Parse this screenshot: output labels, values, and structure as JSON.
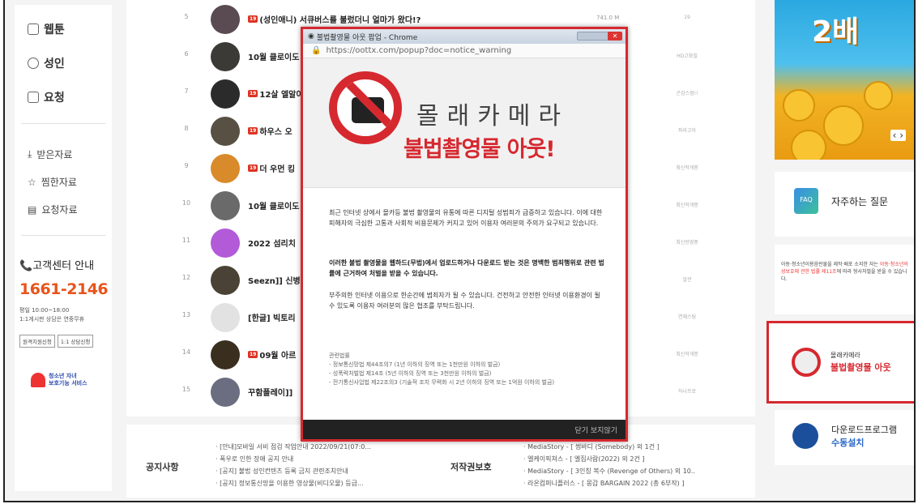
{
  "sidebar": {
    "menu": [
      {
        "label": "웹툰",
        "icon": "book-icon"
      },
      {
        "label": "성인",
        "icon": "adult-icon"
      },
      {
        "label": "요청",
        "icon": "request-icon"
      }
    ],
    "sub": [
      {
        "label": "받은자료",
        "icon": "download-icon"
      },
      {
        "label": "찜한자료",
        "icon": "star-icon"
      },
      {
        "label": "요청자료",
        "icon": "request-list-icon"
      }
    ],
    "cs_title": "고객센터 안내",
    "cs_phone": "1661-2146",
    "cs_hours1": "평일 10:00~18:00",
    "cs_hours2": "1:1게시판 상담은 연중무휴",
    "cs_btn1": "원격지원신청",
    "cs_btn2": "1:1 상담신청",
    "youth1": "청소년 자녀",
    "youth2": "보호기능 서비스"
  },
  "list": [
    {
      "num": "5",
      "title": "(성인애니) 서큐버스를 불렀더니 얼마가 왔다!?",
      "badge": "19",
      "meta": "19",
      "size": "741.0 M",
      "thumb": "#5a4a52"
    },
    {
      "num": "6",
      "title": "10월 클로이도",
      "badge": "",
      "meta": "HD고화질",
      "size": "",
      "thumb": "#3c3a36"
    },
    {
      "num": "7",
      "title": "12살 엘알이",
      "badge": "19",
      "meta": "곤감스점!!",
      "size": "",
      "thumb": "#2b2b2b"
    },
    {
      "num": "8",
      "title": "하우스 오",
      "badge": "19",
      "meta": "파라고아",
      "size": "",
      "thumb": "#585042"
    },
    {
      "num": "9",
      "title": "더 우먼 킹",
      "badge": "19",
      "meta": "최신작개봉",
      "size": "",
      "thumb": "#d98a2a"
    },
    {
      "num": "10",
      "title": "10월 클로이도",
      "badge": "",
      "meta": "최신작개봉",
      "size": "",
      "thumb": "#6a6a6a"
    },
    {
      "num": "11",
      "title": "2022 섬리치",
      "badge": "",
      "meta": "최신방영중",
      "size": "",
      "thumb": "#b25ad8"
    },
    {
      "num": "12",
      "title": "Seezn]] 신병",
      "badge": "",
      "meta": "알관",
      "size": "",
      "thumb": "#4a4234"
    },
    {
      "num": "13",
      "title": "[한글] 빅토리",
      "badge": "",
      "meta": "연체스팀",
      "size": "",
      "thumb": "#e2e2e2"
    },
    {
      "num": "14",
      "title": "09월 아르",
      "badge": "19",
      "meta": "최신작개봉",
      "size": "",
      "thumb": "#3a2e1e"
    },
    {
      "num": "15",
      "title": "꾸함플레이]]",
      "badge": "",
      "meta": "하나프로",
      "size": "",
      "thumb": "#6a6e80"
    }
  ],
  "notice": {
    "title": "공지사항",
    "items": [
      "· [안내]모바일 서비 점검 작업안내 2022/09/21(07:0...",
      "· 폭우로 인한 장애 공지 안내",
      "· [공지] 불법 성인컨텐츠 등록 금지 관련조치안내",
      "· [공지] 정보통신망을 이용한 영상물(비디오물) 등급..."
    ],
    "copyright_title": "저작권보호",
    "copyright_items": [
      "· MediaStory - [ 썸바디 (Somebody) 외 1건 ]",
      "· 엘케이픽쳐스 - [ 엘집사람(2022) 외 2건 ]",
      "· MediaStory - [ 3인칭 복수 (Revenge of Others) 외 10..",
      "· 라온컴퍼니플러스 - [ 몽갑 BARGAIN 2022 (총 6부작) ]"
    ]
  },
  "right": {
    "ad_big": "2배",
    "ad_arrows": "‹ ›",
    "faq_icon": "FAQ",
    "faq": "자주하는 질문",
    "age_notice_1": "아동·청소년이용음란물을 제작·배포 소지한 자는 ",
    "age_notice_red": "아동·청소년의 성보호에 관한 법률 제11조",
    "age_notice_2": "에 따라 형사처벌을 받을 수 있습니다.",
    "hidden_cam_1": "몰래카메라",
    "hidden_cam_2": "불법촬영물 아웃",
    "download_1": "다운로드프로그램",
    "download_2": "수동설치"
  },
  "popup": {
    "window_title": "불법촬영물 아웃 팝업 - Chrome",
    "url": "https://oottx.com/popup?doc=notice_warning",
    "banner_line1": "몰래카메라",
    "banner_line2": "불법촬영물 아웃!",
    "p1": "최근 인터넷 상에서 몰카등 불법 촬영물의 유통에 따른 디지털 성범죄가 급증하고 있습니다. 이에 대한 피해자의 극심한 고통과 사회적 비용문제가 커지고 있어 이용자 여러분의 주의가 요구되고 있습니다.",
    "p2": "이러한 불법 촬영물을 웹하드(무법)에서 업로드하거나 다운로드 받는 것은 명백한 범죄행위로 관련 법률에 근거하여 처벌을 받을 수 있습니다.",
    "p3": "부주의한 인터넷 이용으로 한순간에 범죄자가 될 수 있습니다. 건전하고 안전한 인터넷 이용환경이 될 수 있도록 이용자 여러분의 많은 협조를 부탁드립니다.",
    "law_title": "관련법률",
    "law1": "- 정보통신망법 제44조의7 (1년 이하의 징역 또는 1천만원 이하의 벌금)",
    "law2": "- 성폭력처벌법 제14조 (5년 이하의 징역 또는 3천만원 이하의 벌금)",
    "law3": "- 전기통신사업법 제22조의3 (기술적 조치 무력화 시 2년 이하의 징역 또는 1억원 이하의 벌금)",
    "footer": "닫기 보지않기"
  },
  "colors": {
    "accent": "#d6282f",
    "phone": "#e8541c",
    "link": "#2a68c8"
  }
}
